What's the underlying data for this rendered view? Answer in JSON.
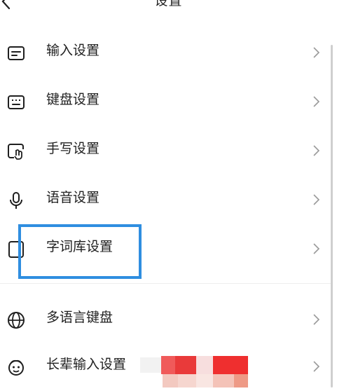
{
  "header": {
    "title": "设置",
    "back_icon": "chevron-left-icon"
  },
  "settings": [
    {
      "id": "input",
      "label": "输入设置",
      "icon": "input-box-icon"
    },
    {
      "id": "keyboard",
      "label": "键盘设置",
      "icon": "keyboard-icon"
    },
    {
      "id": "handwrite",
      "label": "手写设置",
      "icon": "handwriting-icon"
    },
    {
      "id": "voice",
      "label": "语音设置",
      "icon": "microphone-icon"
    },
    {
      "id": "lexicon",
      "label": "字词库设置",
      "icon": "lexicon-icon"
    },
    {
      "id": "multilang",
      "label": "多语言键盘",
      "icon": "globe-icon"
    },
    {
      "id": "elder",
      "label": "长辈输入设置",
      "icon": "elder-face-icon"
    }
  ],
  "colors": {
    "highlight": "#2f8ee0",
    "chevron": "#9a9a9a",
    "icon": "#1f1f1f"
  }
}
